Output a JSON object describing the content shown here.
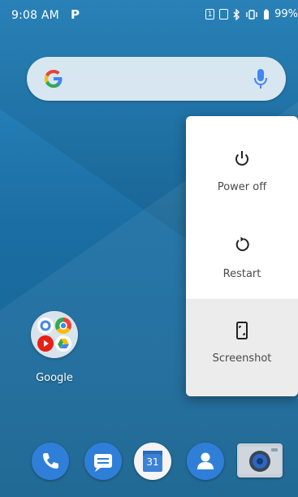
{
  "status_bar": {
    "time": "9:08 AM",
    "notification_letter": "P",
    "sim_label": "1",
    "battery": "99%"
  },
  "search": {
    "logo": "G",
    "icons": [
      "google-g-icon",
      "mic-icon"
    ]
  },
  "power_menu": {
    "items": [
      {
        "label": "Power off",
        "icon": "power-icon"
      },
      {
        "label": "Restart",
        "icon": "restart-icon"
      },
      {
        "label": "Screenshot",
        "icon": "screenshot-icon"
      }
    ]
  },
  "home": {
    "folder_label": "Google"
  },
  "dock": {
    "calendar_day": "31",
    "apps": [
      "phone-icon",
      "messages-icon",
      "calendar-icon",
      "contacts-icon",
      "camera-icon"
    ]
  },
  "colors": {
    "wallpaper_top": "#2c8cc6",
    "wallpaper_bottom": "#14618f",
    "dock_blue": "#2f7fd9",
    "menu_bg": "#ffffff",
    "menu_highlight": "#ececec"
  }
}
